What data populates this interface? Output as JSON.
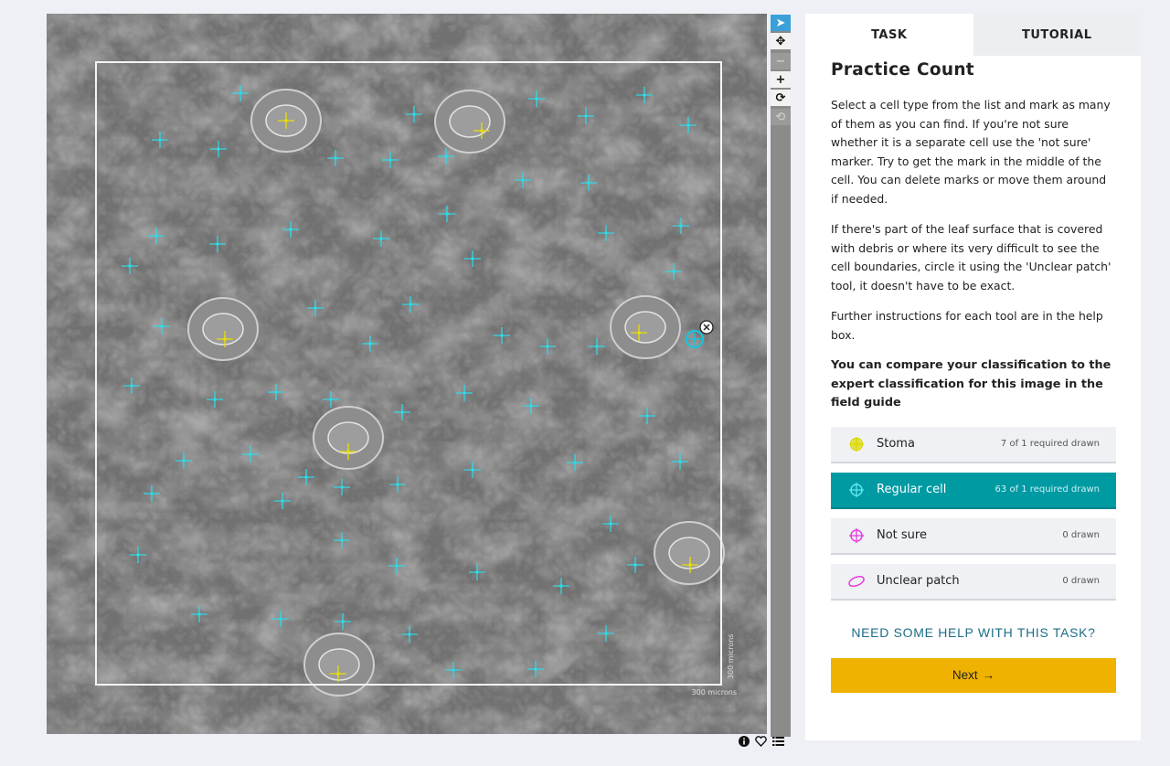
{
  "panel": {
    "tabs": [
      {
        "label": "TASK",
        "active": true
      },
      {
        "label": "TUTORIAL",
        "active": false
      }
    ],
    "title": "Practice Count",
    "paragraphs": [
      "Select a cell type from the list and mark as many of them as you can find. If you're not sure whether it is a separate cell use the 'not sure' marker. Try to get the mark in the middle of the cell. You can delete marks or move them around if needed.",
      "If there's part of the leaf surface that is covered with debris or where its very difficult to see the cell boundaries, circle it using the 'Unclear patch' tool, it doesn't have to be exact.",
      "Further instructions for each tool are in the help box."
    ],
    "compare_note": "You can compare your classification to the expert classification for this image in the field guide",
    "tools": [
      {
        "label": "Stoma",
        "count": "7 of 1 required drawn",
        "icon": "stoma-marker-icon",
        "color": "#dcd800",
        "selected": false
      },
      {
        "label": "Regular cell",
        "count": "63 of 1 required drawn",
        "icon": "crosshair-icon",
        "color": "#5ee7f2",
        "selected": true
      },
      {
        "label": "Not sure",
        "count": "0 drawn",
        "icon": "crosshair-icon",
        "color": "#e63ddf",
        "selected": false
      },
      {
        "label": "Unclear patch",
        "count": "0 drawn",
        "icon": "ellipse-icon",
        "color": "#e63ddf",
        "selected": false
      }
    ],
    "help_link": "NEED SOME HELP WITH THIS TASK?",
    "next_label": "Next",
    "next_arrow": "→"
  },
  "viewer": {
    "scale_bar_bottom": "300 microns",
    "scale_bar_side": "300 microns",
    "toolbar": [
      {
        "name": "pointer-tool",
        "glyph": "➤",
        "state": "active"
      },
      {
        "name": "move-tool",
        "glyph": "✥",
        "state": "normal"
      },
      {
        "name": "zoom-out-tool",
        "glyph": "−",
        "state": "disabled"
      },
      {
        "name": "zoom-in-tool",
        "glyph": "+",
        "state": "normal"
      },
      {
        "name": "rotate-tool",
        "glyph": "⟳",
        "state": "normal"
      },
      {
        "name": "reset-tool",
        "glyph": "⟲",
        "state": "disabled"
      }
    ],
    "colors": {
      "regular_marker": "#2fd9e6",
      "stoma_marker": "#e8e000",
      "selection": "#19c3dc"
    }
  },
  "subject_icons": [
    "info-icon",
    "heart-icon",
    "collections-icon"
  ]
}
